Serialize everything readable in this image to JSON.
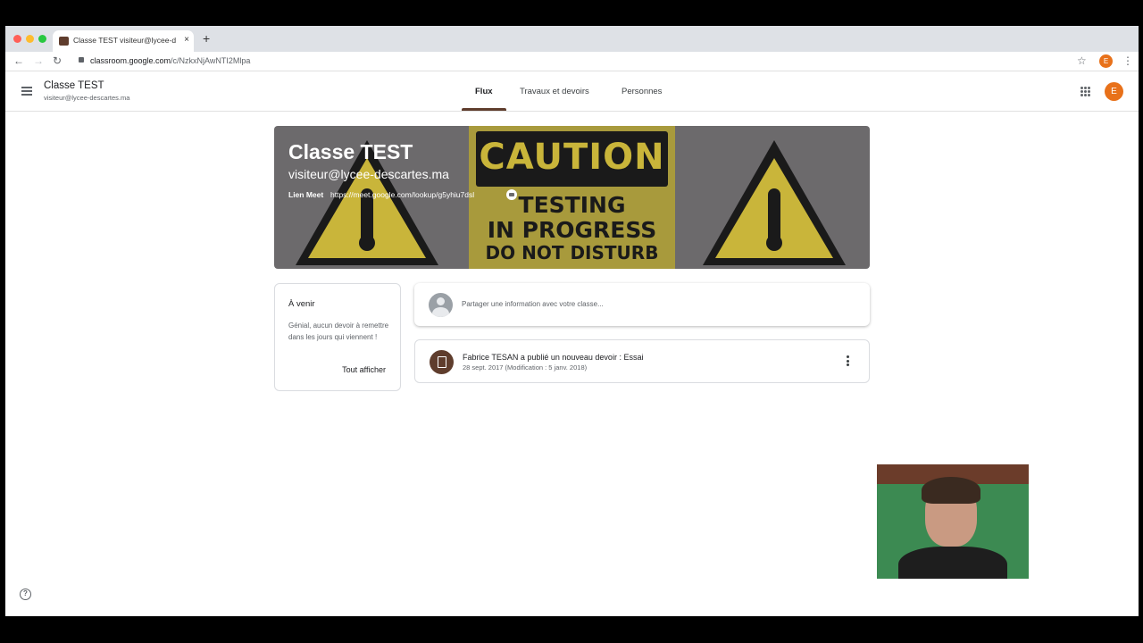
{
  "browser": {
    "tab_title": "Classe TEST visiteur@lycee-des",
    "tab_close": "×",
    "new_tab": "+",
    "url_host": "classroom.google.com",
    "url_path": "/c/NzkxNjAwNTI2Mlpa",
    "profile_initial": "E"
  },
  "header": {
    "class_name": "Classe TEST",
    "class_email": "visiteur@lycee-descartes.ma",
    "tabs": [
      "Flux",
      "Travaux et devoirs",
      "Personnes"
    ],
    "active_tab": "Flux",
    "avatar_initial": "E"
  },
  "banner": {
    "title": "Classe TEST",
    "subtitle": "visiteur@lycee-descartes.ma",
    "meet_label": "Lien Meet",
    "meet_link": "https://meet.google.com/lookup/g5yhiu7dsl",
    "sign_caution": "CAUTION",
    "sign_line1": "TESTING",
    "sign_line2": "IN PROGRESS",
    "sign_line3": "DO NOT DISTURB"
  },
  "upcoming": {
    "title": "À venir",
    "text": "Génial, aucun devoir à remettre dans les jours qui viennent !",
    "view_all": "Tout afficher"
  },
  "stream": {
    "share_placeholder": "Partager une information avec votre classe...",
    "post_title": "Fabrice TESAN a publié un nouveau devoir : Essai",
    "post_date": "28 sept. 2017 (Modification : 5 janv. 2018)"
  },
  "help_icon": "?",
  "colors": {
    "theme": "#5f3d2d",
    "avatar": "#e8711a",
    "banner_bg": "#6c6a6c"
  }
}
